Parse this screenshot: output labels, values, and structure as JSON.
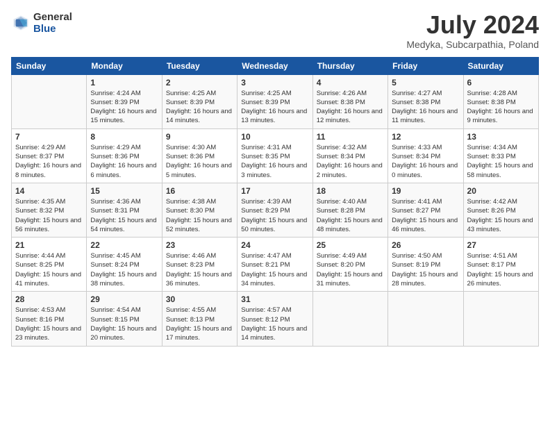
{
  "header": {
    "logo_general": "General",
    "logo_blue": "Blue",
    "month": "July 2024",
    "location": "Medyka, Subcarpathia, Poland"
  },
  "calendar": {
    "days_of_week": [
      "Sunday",
      "Monday",
      "Tuesday",
      "Wednesday",
      "Thursday",
      "Friday",
      "Saturday"
    ],
    "weeks": [
      [
        {
          "day": "",
          "info": ""
        },
        {
          "day": "1",
          "info": "Sunrise: 4:24 AM\nSunset: 8:39 PM\nDaylight: 16 hours and 15 minutes."
        },
        {
          "day": "2",
          "info": "Sunrise: 4:25 AM\nSunset: 8:39 PM\nDaylight: 16 hours and 14 minutes."
        },
        {
          "day": "3",
          "info": "Sunrise: 4:25 AM\nSunset: 8:39 PM\nDaylight: 16 hours and 13 minutes."
        },
        {
          "day": "4",
          "info": "Sunrise: 4:26 AM\nSunset: 8:38 PM\nDaylight: 16 hours and 12 minutes."
        },
        {
          "day": "5",
          "info": "Sunrise: 4:27 AM\nSunset: 8:38 PM\nDaylight: 16 hours and 11 minutes."
        },
        {
          "day": "6",
          "info": "Sunrise: 4:28 AM\nSunset: 8:38 PM\nDaylight: 16 hours and 9 minutes."
        }
      ],
      [
        {
          "day": "7",
          "info": "Sunrise: 4:29 AM\nSunset: 8:37 PM\nDaylight: 16 hours and 8 minutes."
        },
        {
          "day": "8",
          "info": "Sunrise: 4:29 AM\nSunset: 8:36 PM\nDaylight: 16 hours and 6 minutes."
        },
        {
          "day": "9",
          "info": "Sunrise: 4:30 AM\nSunset: 8:36 PM\nDaylight: 16 hours and 5 minutes."
        },
        {
          "day": "10",
          "info": "Sunrise: 4:31 AM\nSunset: 8:35 PM\nDaylight: 16 hours and 3 minutes."
        },
        {
          "day": "11",
          "info": "Sunrise: 4:32 AM\nSunset: 8:34 PM\nDaylight: 16 hours and 2 minutes."
        },
        {
          "day": "12",
          "info": "Sunrise: 4:33 AM\nSunset: 8:34 PM\nDaylight: 16 hours and 0 minutes."
        },
        {
          "day": "13",
          "info": "Sunrise: 4:34 AM\nSunset: 8:33 PM\nDaylight: 15 hours and 58 minutes."
        }
      ],
      [
        {
          "day": "14",
          "info": "Sunrise: 4:35 AM\nSunset: 8:32 PM\nDaylight: 15 hours and 56 minutes."
        },
        {
          "day": "15",
          "info": "Sunrise: 4:36 AM\nSunset: 8:31 PM\nDaylight: 15 hours and 54 minutes."
        },
        {
          "day": "16",
          "info": "Sunrise: 4:38 AM\nSunset: 8:30 PM\nDaylight: 15 hours and 52 minutes."
        },
        {
          "day": "17",
          "info": "Sunrise: 4:39 AM\nSunset: 8:29 PM\nDaylight: 15 hours and 50 minutes."
        },
        {
          "day": "18",
          "info": "Sunrise: 4:40 AM\nSunset: 8:28 PM\nDaylight: 15 hours and 48 minutes."
        },
        {
          "day": "19",
          "info": "Sunrise: 4:41 AM\nSunset: 8:27 PM\nDaylight: 15 hours and 46 minutes."
        },
        {
          "day": "20",
          "info": "Sunrise: 4:42 AM\nSunset: 8:26 PM\nDaylight: 15 hours and 43 minutes."
        }
      ],
      [
        {
          "day": "21",
          "info": "Sunrise: 4:44 AM\nSunset: 8:25 PM\nDaylight: 15 hours and 41 minutes."
        },
        {
          "day": "22",
          "info": "Sunrise: 4:45 AM\nSunset: 8:24 PM\nDaylight: 15 hours and 38 minutes."
        },
        {
          "day": "23",
          "info": "Sunrise: 4:46 AM\nSunset: 8:23 PM\nDaylight: 15 hours and 36 minutes."
        },
        {
          "day": "24",
          "info": "Sunrise: 4:47 AM\nSunset: 8:21 PM\nDaylight: 15 hours and 34 minutes."
        },
        {
          "day": "25",
          "info": "Sunrise: 4:49 AM\nSunset: 8:20 PM\nDaylight: 15 hours and 31 minutes."
        },
        {
          "day": "26",
          "info": "Sunrise: 4:50 AM\nSunset: 8:19 PM\nDaylight: 15 hours and 28 minutes."
        },
        {
          "day": "27",
          "info": "Sunrise: 4:51 AM\nSunset: 8:17 PM\nDaylight: 15 hours and 26 minutes."
        }
      ],
      [
        {
          "day": "28",
          "info": "Sunrise: 4:53 AM\nSunset: 8:16 PM\nDaylight: 15 hours and 23 minutes."
        },
        {
          "day": "29",
          "info": "Sunrise: 4:54 AM\nSunset: 8:15 PM\nDaylight: 15 hours and 20 minutes."
        },
        {
          "day": "30",
          "info": "Sunrise: 4:55 AM\nSunset: 8:13 PM\nDaylight: 15 hours and 17 minutes."
        },
        {
          "day": "31",
          "info": "Sunrise: 4:57 AM\nSunset: 8:12 PM\nDaylight: 15 hours and 14 minutes."
        },
        {
          "day": "",
          "info": ""
        },
        {
          "day": "",
          "info": ""
        },
        {
          "day": "",
          "info": ""
        }
      ]
    ]
  }
}
